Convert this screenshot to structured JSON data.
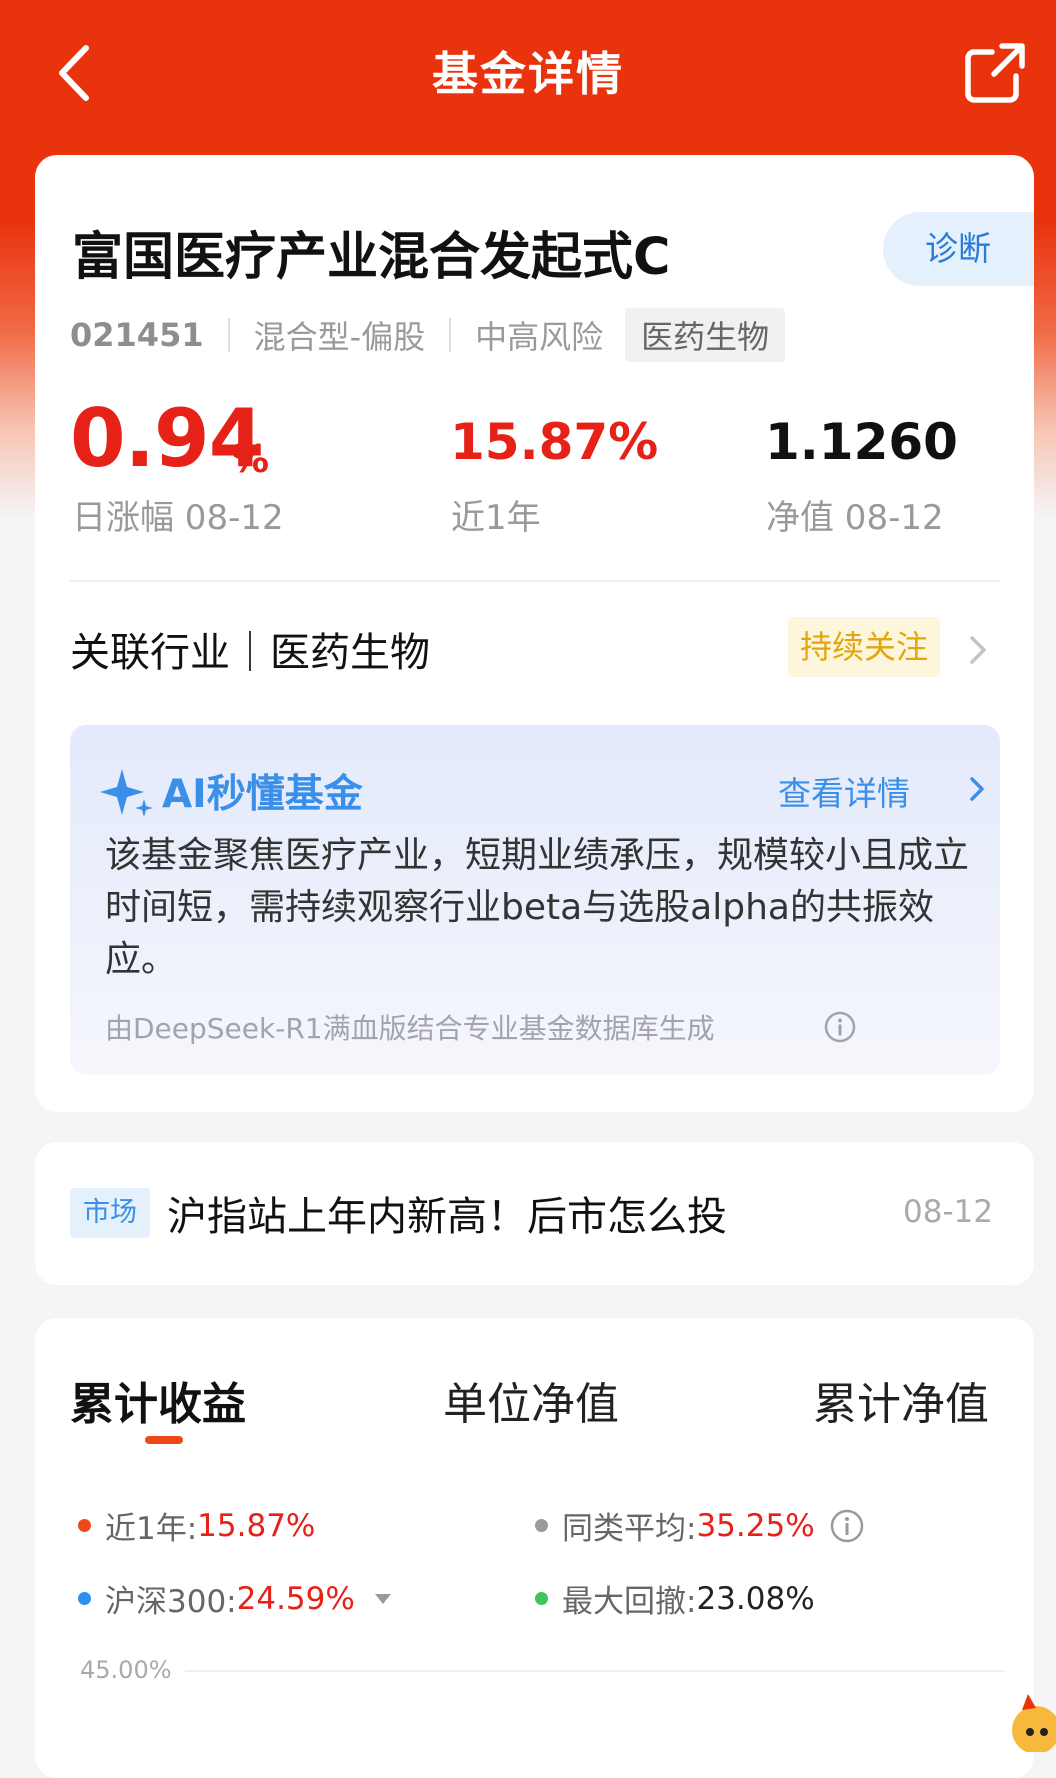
{
  "header": {
    "title": "基金详情"
  },
  "fund": {
    "name": "富国医疗产业混合发起式C",
    "diagnose_label": "诊断",
    "code": "021451",
    "type": "混合型-偏股",
    "risk": "中高风险",
    "sector_tag": "医药生物",
    "daily_change_value": "0.94",
    "daily_change_unit": "%",
    "daily_change_label": "日涨幅 08-12",
    "one_year_value": "15.87%",
    "one_year_label": "近1年",
    "nav_value": "1.1260",
    "nav_label": "净值 08-12",
    "industry_text": "关联行业｜医药生物",
    "follow_label": "持续关注"
  },
  "ai": {
    "title": "AI秒懂基金",
    "more_label": "查看详情",
    "text": "该基金聚焦医疗产业，短期业绩承压，规模较小且成立时间短，需持续观察行业beta与选股alpha的共振效应。",
    "source": "由DeepSeek-R1满血版结合专业基金数据库生成"
  },
  "news": {
    "tag": "市场",
    "title": "沪指站上年内新高！后市怎么投",
    "date": "08-12"
  },
  "chart_tabs": [
    "累计收益",
    "单位净值",
    "累计净值"
  ],
  "legend": [
    {
      "label": "近1年:",
      "value": "15.87%",
      "color": "#ee4a19"
    },
    {
      "label": "同类平均:",
      "value": "35.25%",
      "color": "#9a9a9a"
    },
    {
      "label": "沪深300:",
      "value": "24.59%",
      "color": "#2d8ff0"
    },
    {
      "label": "最大回撤:",
      "value": "23.08%",
      "color": "#3ec45a"
    }
  ],
  "chart_data": {
    "type": "line",
    "y_ticks": [
      "45.00%"
    ],
    "series": [
      {
        "name": "近1年",
        "values": []
      },
      {
        "name": "同类平均",
        "values": []
      },
      {
        "name": "沪深300",
        "values": []
      }
    ]
  }
}
